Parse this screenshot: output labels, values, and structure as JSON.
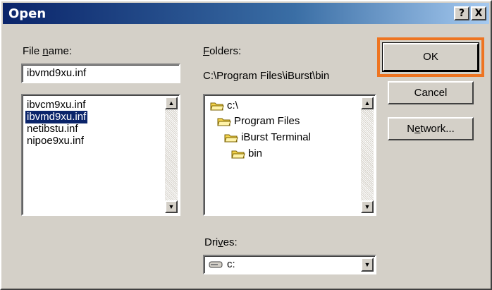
{
  "window": {
    "title": "Open",
    "help_label": "?",
    "close_label": "X"
  },
  "file_name": {
    "label_prefix": "File ",
    "label_accel": "n",
    "label_rest": "ame:",
    "value": "ibvmd9xu.inf",
    "items": [
      "ibvcm9xu.inf",
      "ibvmd9xu.inf",
      "netibstu.inf",
      "nipoe9xu.inf"
    ],
    "selected_index": 1
  },
  "folders": {
    "label_accel": "F",
    "label_rest": "olders:",
    "current_path": "C:\\Program Files\\iBurst\\bin",
    "tree": [
      "c:\\",
      "Program Files",
      "iBurst Terminal",
      "bin"
    ]
  },
  "drives": {
    "label_prefix": "Dri",
    "label_accel": "v",
    "label_rest": "es:",
    "selected": "c:"
  },
  "buttons": {
    "ok": "OK",
    "cancel": "Cancel",
    "network_prefix": "N",
    "network_accel": "e",
    "network_rest": "twork..."
  },
  "icons": {
    "folder": "folder-open-icon",
    "drive": "hard-drive-icon",
    "scroll_up": "scroll-up-icon",
    "scroll_down": "scroll-down-icon",
    "dropdown": "chevron-down-icon"
  },
  "colors": {
    "highlight_border": "#ee7421",
    "title_bar_start": "#0a246a",
    "selection": "#0a246a"
  }
}
